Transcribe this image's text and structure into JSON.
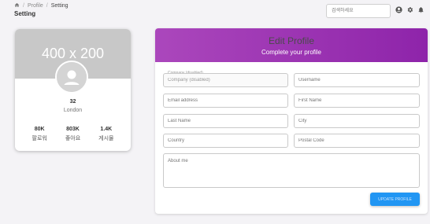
{
  "breadcrumb": {
    "items": [
      "Profile",
      "Setting"
    ],
    "separator": "/"
  },
  "page_title": "Setting",
  "search": {
    "placeholder": "검색하세요",
    "value": ""
  },
  "header_icons": [
    "account-icon",
    "settings-icon",
    "notifications-icon"
  ],
  "profile": {
    "cover_text": "400 x 200",
    "name": "32",
    "location": "London",
    "stats": [
      {
        "value": "80K",
        "label": "팔로워"
      },
      {
        "value": "803K",
        "label": "좋아요"
      },
      {
        "value": "1.4K",
        "label": "게시물"
      }
    ]
  },
  "edit_profile": {
    "title": "Edit Profile",
    "subtitle": "Complete your profile",
    "company_legend": "Company (disabled)",
    "company_value": "Company (disabled)",
    "fields": {
      "username": "Username",
      "email": "Email address",
      "first_name": "First Name",
      "last_name": "Last Name",
      "city": "City",
      "country": "Country",
      "postal_code": "Postal Code",
      "about_me": "About me"
    },
    "submit_label": "Update Profile"
  },
  "colors": {
    "header_gradient_start": "#ab47bc",
    "header_gradient_end": "#8e24aa",
    "button": "#2196f3"
  }
}
